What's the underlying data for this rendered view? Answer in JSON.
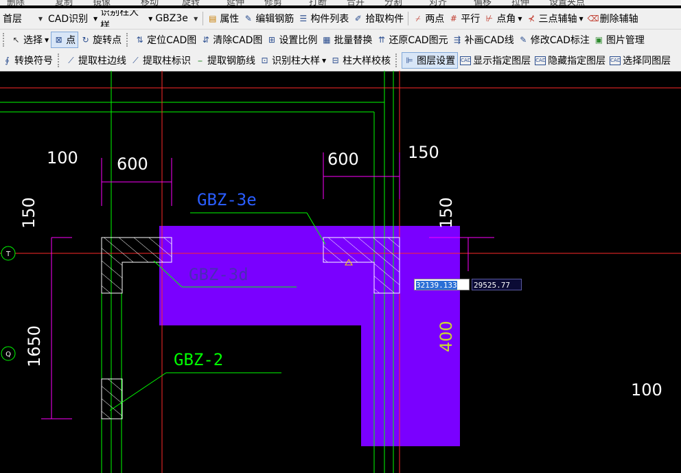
{
  "toolbar_top_strip": [
    "删除",
    "复制",
    "镜像",
    "移动",
    "旋转",
    "延伸",
    "修剪",
    "打断",
    "合并",
    "分割",
    "对齐",
    "偏移",
    "拉伸",
    "设置夹点"
  ],
  "toolbar1": {
    "floor": "首层",
    "cad_recog": "CAD识别",
    "recog_col": "识别柱大样",
    "component": "GBZ3e",
    "items": [
      "属性",
      "编辑钢筋",
      "构件列表",
      "拾取构件",
      "两点",
      "平行",
      "点角",
      "三点辅轴",
      "删除辅轴"
    ]
  },
  "toolbar2": {
    "items": [
      "选择",
      "点",
      "旋转点",
      "定位CAD图",
      "清除CAD图",
      "设置比例",
      "批量替换",
      "还原CAD图元",
      "补画CAD线",
      "修改CAD标注",
      "图片管理"
    ]
  },
  "toolbar3": {
    "items": [
      "转换符号",
      "提取柱边线",
      "提取柱标识",
      "提取钢筋线",
      "识别柱大样",
      "柱大样校核",
      "图层设置",
      "显示指定图层",
      "隐藏指定图层",
      "选择同图层"
    ]
  },
  "drawing": {
    "dims": [
      "100",
      "600",
      "600",
      "150",
      "150",
      "1650",
      "400",
      "100"
    ],
    "labels": [
      "GBZ-3e",
      "GBZ-3d",
      "GBZ-2"
    ],
    "axis_markers": [
      "T",
      "Q"
    ],
    "colors": {
      "fill": "#7a00ff",
      "axis": "#ff2a2a",
      "wall": "#00ff00",
      "dim": "#ff00ff",
      "text": "#ffffff",
      "blue_label": "#2a5dff",
      "green_label": "#00ff00",
      "hatch": "#ffffff",
      "yellow": "#c8d832"
    }
  },
  "coords": {
    "x": "32139.133",
    "y": "29525.77"
  }
}
